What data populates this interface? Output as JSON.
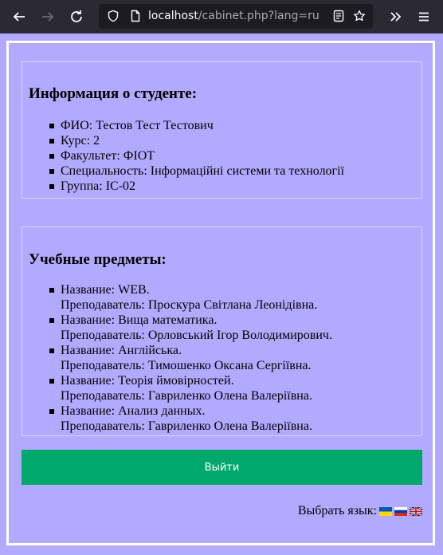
{
  "browser": {
    "url_host": "localhost",
    "url_path": "/cabinet.php?lang=ru"
  },
  "student_info": {
    "title": "Информация о студенте:",
    "items": [
      "ФИО: Тестов Тест Тестович",
      "Курс: 2",
      "Факультет: ФІОТ",
      "Специальность: Інформаційні системи та технології",
      "Группа: ІС-02"
    ]
  },
  "subjects": {
    "title": "Учебные предметы:",
    "items": [
      {
        "name": "Название: WEB.",
        "teacher": "Преподаватель: Проскура Світлана Леонідівна."
      },
      {
        "name": "Название: Вища математика.",
        "teacher": "Преподаватель: Орловський Ігор Володимирович."
      },
      {
        "name": "Название: Англійська.",
        "teacher": "Преподаватель: Тимошенко Оксана Сергіївна."
      },
      {
        "name": "Название: Теорія ймовірностей.",
        "teacher": "Преподаватель: Гавриленко Олена Валеріївна."
      },
      {
        "name": "Название: Анализ данных.",
        "teacher": "Преподаватель: Гавриленко Олена Валеріївна."
      }
    ]
  },
  "logout_label": "Выйти",
  "language": {
    "label": "Выбрать язык:",
    "flags": [
      "ukraine-flag-icon",
      "russia-flag-icon",
      "uk-flag-icon"
    ]
  },
  "colors": {
    "page_bg": "#b2aafe",
    "button_bg": "#00a86b",
    "button_text": "#ffffff"
  }
}
